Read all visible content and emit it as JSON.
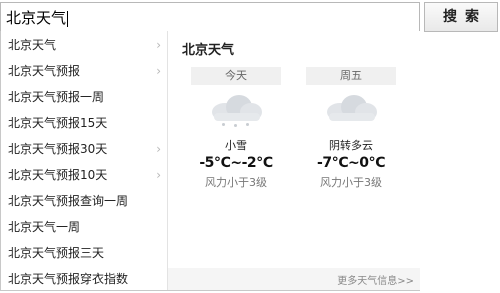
{
  "search": {
    "value": "北京天气",
    "button_label": "搜索"
  },
  "suggestions": [
    {
      "label": "北京天气",
      "has_arrow": true
    },
    {
      "label": "北京天气预报",
      "has_arrow": true
    },
    {
      "label": "北京天气预报一周",
      "has_arrow": false
    },
    {
      "label": "北京天气预报15天",
      "has_arrow": false
    },
    {
      "label": "北京天气预报30天",
      "has_arrow": true
    },
    {
      "label": "北京天气预报10天",
      "has_arrow": true
    },
    {
      "label": "北京天气预报查询一周",
      "has_arrow": false
    },
    {
      "label": "北京天气一周",
      "has_arrow": false
    },
    {
      "label": "北京天气预报三天",
      "has_arrow": false
    },
    {
      "label": "北京天气预报穿衣指数",
      "has_arrow": false
    }
  ],
  "weather": {
    "title": "北京天气",
    "days": [
      {
        "label": "今天",
        "condition": "小雪",
        "temp": "-5℃~-2℃",
        "wind": "风力小于3级",
        "icon": "snow-cloud-icon"
      },
      {
        "label": "周五",
        "condition": "阴转多云",
        "temp": "-7℃~0℃",
        "wind": "风力小于3级",
        "icon": "overcast-cloud-icon"
      }
    ],
    "more_link": "更多天气信息>>"
  },
  "colors": {
    "border": "#b8b8b8",
    "header_bg": "#f0f0f0",
    "footer_bg": "#f5f5f5"
  }
}
